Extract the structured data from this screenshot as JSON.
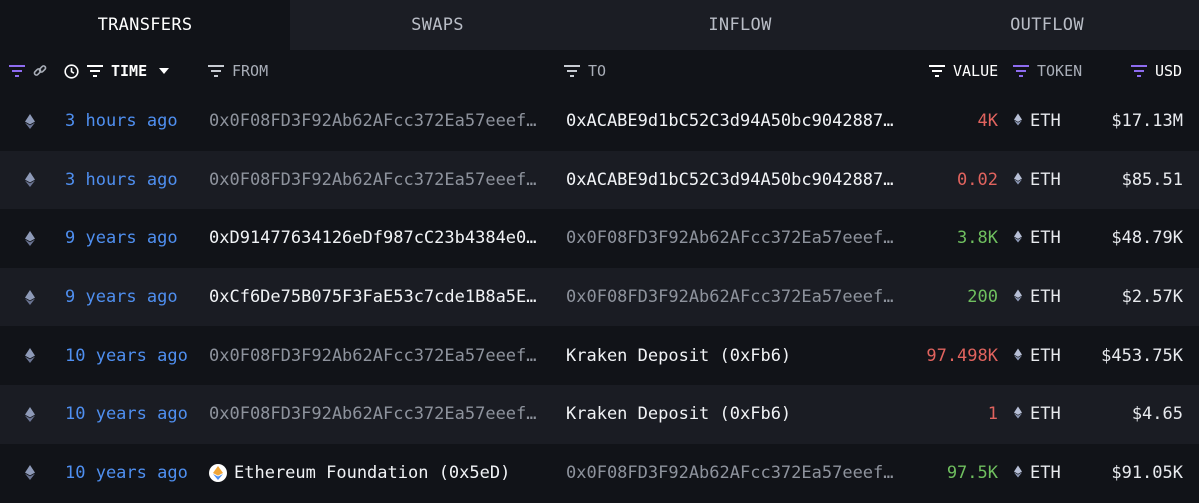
{
  "tabs": [
    {
      "label": "TRANSFERS",
      "active": true
    },
    {
      "label": "SWAPS",
      "active": false
    },
    {
      "label": "INFLOW",
      "active": false
    },
    {
      "label": "OUTFLOW",
      "active": false
    }
  ],
  "columns": {
    "time": "TIME",
    "from": "FROM",
    "to": "TO",
    "value": "VALUE",
    "token": "TOKEN",
    "usd": "USD"
  },
  "colors": {
    "accent_filter": "#8e6cf0",
    "time_link": "#4f8ff0",
    "negative": "#e0635e",
    "positive": "#6fbf5f"
  },
  "icons": {
    "chain": "ethereum-icon",
    "link": "link-icon",
    "clock": "clock-icon",
    "filter": "filter-icon",
    "sort": "caret-down-icon"
  },
  "rows": [
    {
      "time": "3 hours ago",
      "from": "0x0F08FD3F92Ab62AFcc372Ea57eeef…",
      "to": "0xACABE9d1bC52C3d94A50bc9042887…",
      "value": "4K",
      "direction": "out",
      "token": "ETH",
      "usd": "$17.13M"
    },
    {
      "time": "3 hours ago",
      "from": "0x0F08FD3F92Ab62AFcc372Ea57eeef…",
      "to": "0xACABE9d1bC52C3d94A50bc9042887…",
      "value": "0.02",
      "direction": "out",
      "token": "ETH",
      "usd": "$85.51"
    },
    {
      "time": "9 years ago",
      "from": "0xD91477634126eDf987cC23b4384e0…",
      "to": "0x0F08FD3F92Ab62AFcc372Ea57eeef…",
      "value": "3.8K",
      "direction": "in",
      "token": "ETH",
      "usd": "$48.79K"
    },
    {
      "time": "9 years ago",
      "from": "0xCf6De75B075F3FaE53c7cde1B8a5E…",
      "to": "0x0F08FD3F92Ab62AFcc372Ea57eeef…",
      "value": "200",
      "direction": "in",
      "token": "ETH",
      "usd": "$2.57K"
    },
    {
      "time": "10 years ago",
      "from": "0x0F08FD3F92Ab62AFcc372Ea57eeef…",
      "to": "Kraken Deposit (0xFb6)",
      "value": "97.498K",
      "direction": "out",
      "token": "ETH",
      "usd": "$453.75K"
    },
    {
      "time": "10 years ago",
      "from": "0x0F08FD3F92Ab62AFcc372Ea57eeef…",
      "to": "Kraken Deposit (0xFb6)",
      "value": "1",
      "direction": "out",
      "token": "ETH",
      "usd": "$4.65"
    },
    {
      "time": "10 years ago",
      "from": "Ethereum Foundation (0x5eD)",
      "to": "0x0F08FD3F92Ab62AFcc372Ea57eeef…",
      "value": "97.5K",
      "direction": "in",
      "token": "ETH",
      "usd": "$91.05K"
    }
  ]
}
